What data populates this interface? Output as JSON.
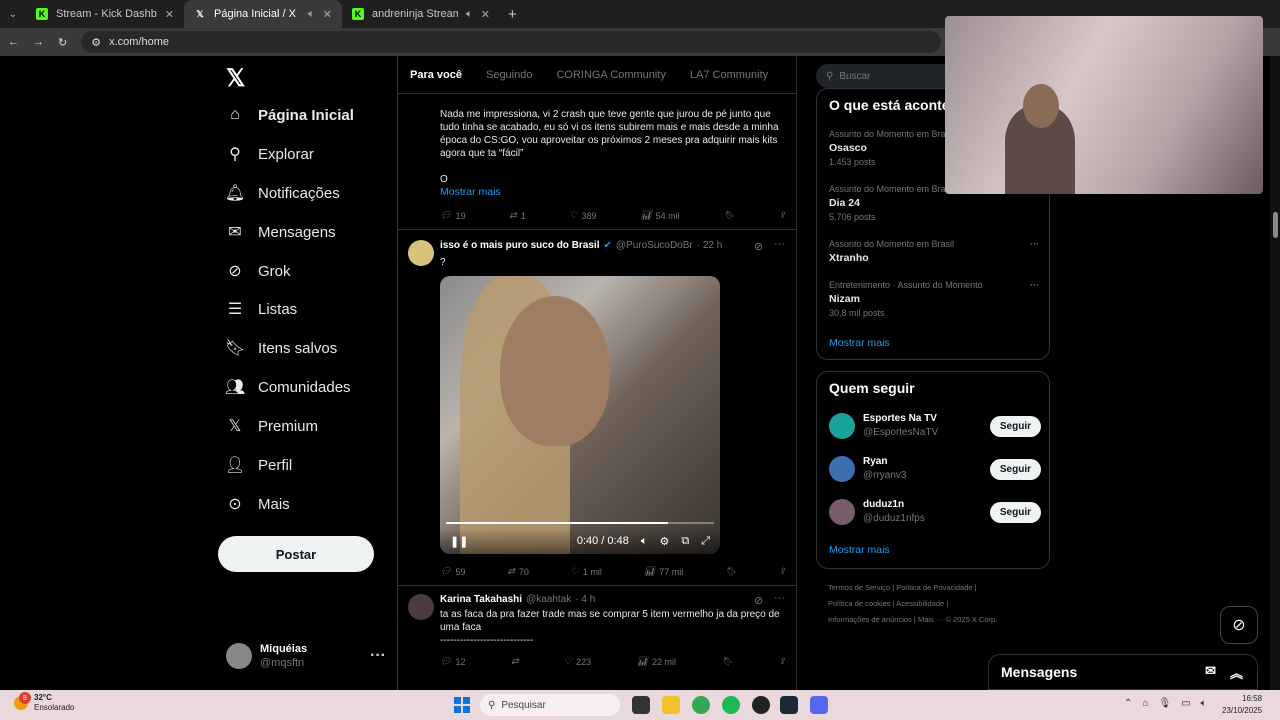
{
  "browser": {
    "tabs": [
      {
        "title": "Stream - Kick Dashboard",
        "active": false
      },
      {
        "title": "Página Inicial / X",
        "active": true
      },
      {
        "title": "andreninja Stream - Watch",
        "active": false
      }
    ],
    "url": "x.com/home"
  },
  "sidebar": {
    "items": [
      {
        "label": "Página Inicial",
        "icon": "home-icon"
      },
      {
        "label": "Explorar",
        "icon": "search-icon"
      },
      {
        "label": "Notificações",
        "icon": "bell-icon"
      },
      {
        "label": "Mensagens",
        "icon": "mail-icon"
      },
      {
        "label": "Grok",
        "icon": "grok-icon"
      },
      {
        "label": "Listas",
        "icon": "list-icon"
      },
      {
        "label": "Itens salvos",
        "icon": "bookmark-icon"
      },
      {
        "label": "Comunidades",
        "icon": "communities-icon"
      },
      {
        "label": "Premium",
        "icon": "x-icon"
      },
      {
        "label": "Perfil",
        "icon": "person-icon"
      },
      {
        "label": "Mais",
        "icon": "more-circle-icon"
      }
    ],
    "post_label": "Postar",
    "user": {
      "name": "Miquéias",
      "handle": "@mqsftn"
    }
  },
  "feed": {
    "tabs": [
      "Para você",
      "Seguindo",
      "CORINGA Community",
      "LA7 Community"
    ],
    "tweet1": {
      "lines": [
        "Nada me impressiona, vi 2 crash que teve gente que jurou de pé junto que",
        "tudo tinha se acabado, eu só vi os itens subirem mais e mais desde a minha",
        "época do CS:GO, vou aproveitar os próximos 2 meses pra adquirir mais kits",
        "agora que ta “fácil”"
      ],
      "extra": "O",
      "show_more": "Mostrar mais",
      "replies": "19",
      "reposts": "1",
      "likes": "389",
      "views": "54 mil"
    },
    "tweet2": {
      "name": "isso é o mais puro suco do Brasil",
      "handle": "@PuroSucoDoBr",
      "time": "· 22 h",
      "text": "?",
      "video_time": "0:40 / 0:48",
      "progress": 0.83,
      "replies": "59",
      "reposts": "70",
      "likes": "1 mil",
      "views": "77 mil"
    },
    "tweet3": {
      "name": "Karina Takahashi",
      "handle": "@kaahtak",
      "time": "· 4 h",
      "lines": [
        "ta as faca da pra fazer trade mas se comprar 5 item vermelho ja da preço de",
        "uma faca",
        "----------------------------"
      ],
      "replies": "12",
      "reposts": "",
      "likes": "223",
      "views": "22 mil"
    }
  },
  "right": {
    "search_placeholder": "Buscar",
    "trends_title": "O que está aconte",
    "trends": [
      {
        "context": "Assunto do Momento em Brasi",
        "name": "Osasco",
        "posts": "1.453 posts"
      },
      {
        "context": "Assunto do Momento em Bras",
        "name": "Dia 24",
        "posts": "5.706 posts"
      },
      {
        "context": "Assunto do Momento em Brasil",
        "name": "Xtranho",
        "posts": ""
      },
      {
        "context": "Entretenimento · Assunto do Momento",
        "name": "Nizam",
        "posts": "30,8 mil posts"
      }
    ],
    "trends_more": "Mostrar mais",
    "follow_title": "Quem seguir",
    "follow": [
      {
        "name": "Esportes Na TV",
        "handle": "@EsportesNaTV",
        "button": "Seguir",
        "color": "#1aa39a"
      },
      {
        "name": "Ryan",
        "handle": "@rryanv3",
        "button": "Seguir",
        "color": "#3b6fb0"
      },
      {
        "name": "duduz1n",
        "handle": "@duduz1nfps",
        "button": "Seguir",
        "color": "#7a5b6a"
      }
    ],
    "follow_more": "Mostrar mais",
    "footer": [
      "Termos de Serviço",
      "|",
      "Política de Privacidade",
      "|",
      "Política de cookies",
      "|",
      "Acessibilidade",
      "|",
      "Informações de anúncios",
      "|",
      "Mais ···",
      "© 2025 X Corp."
    ]
  },
  "messages_label": "Mensagens",
  "taskbar": {
    "temp": "32°C",
    "weather": "Ensolarado",
    "badge": "8",
    "search": "Pesquisar",
    "time": "16:58",
    "date": "23/10/2025"
  }
}
